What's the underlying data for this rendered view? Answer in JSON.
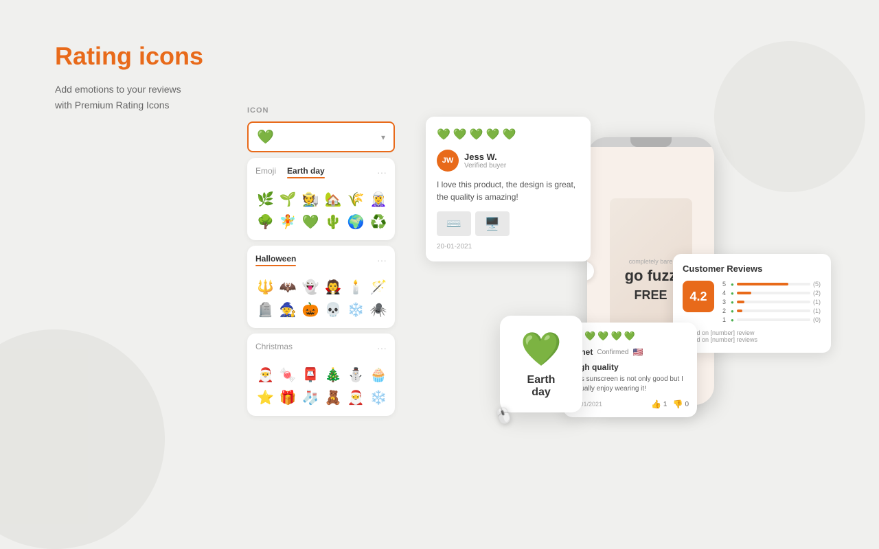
{
  "page": {
    "title": "Rating icons",
    "subtitle_line1": "Add emotions to your reviews",
    "subtitle_line2": "with Premium Rating Icons"
  },
  "icon_section": {
    "label": "ICON",
    "selected_icon_emoji": "💚",
    "tabs": [
      {
        "id": "emoji",
        "label": "Emoji",
        "active": false
      },
      {
        "id": "earthday",
        "label": "Earth day",
        "active": true
      }
    ],
    "earthday_emojis_row1": [
      "🌿",
      "🌱",
      "🧑‍🌾",
      "🏡",
      "🌾",
      "🧝‍♀️"
    ],
    "earthday_emojis_row2": [
      "🌳",
      "🧚",
      "💚",
      "🌵",
      "🌍",
      "♻️"
    ],
    "halloween_section_label": "Halloween",
    "halloween_emojis_row1": [
      "🔱",
      "🦇",
      "👻",
      "🧛",
      "🕯️",
      "🪄"
    ],
    "halloween_emojis_row2": [
      "🪦",
      "🧙",
      "🎃",
      "💀",
      "❄️",
      "🕷️"
    ],
    "christmas_section_label": "Christmas",
    "christmas_emojis_row1": [
      "🎅",
      "🍬",
      "📮",
      "🎄",
      "⛄",
      "🧁"
    ],
    "christmas_emojis_row2": [
      "⭐",
      "🎁",
      "🧦",
      "🧸",
      "🎅",
      "❄️"
    ]
  },
  "review_card": {
    "reviewer_initials": "JW",
    "reviewer_name": "Jess W.",
    "verified_text": "Verified buyer",
    "review_text": "I love this product, the design is great, the quality is amazing!",
    "date": "20-01-2021",
    "stars_count": 5
  },
  "customer_reviews": {
    "title": "Customer Reviews",
    "score": "4.2",
    "bars": [
      {
        "label": "5",
        "fill_percent": 70,
        "count": "(5)"
      },
      {
        "label": "4",
        "fill_percent": 20,
        "count": "(2)"
      },
      {
        "label": "3",
        "fill_percent": 10,
        "count": "(1)"
      },
      {
        "label": "2",
        "fill_percent": 8,
        "count": "(1)"
      },
      {
        "label": "1",
        "fill_percent": 0,
        "count": "(0)"
      }
    ],
    "info_line1": "Based on [number] review",
    "info_line2": "Based on [number] reviews"
  },
  "earthday_tooltip": {
    "emoji": "💚",
    "label": "Earth day"
  },
  "mobile_review": {
    "reviewer_name": "Janet",
    "confirmed_text": "Confirmed",
    "flag": "🇺🇸",
    "stars_count": 5,
    "title": "High quality",
    "text": "This sunscreen is not only good but I actually enjoy wearing it!",
    "date": "01/01/2021",
    "helpful_up": "1",
    "helpful_down": "0"
  },
  "phone": {
    "product_text_line1": "completely bare",
    "product_text_line2": "go fuzz",
    "product_text_line3": "FREE"
  }
}
